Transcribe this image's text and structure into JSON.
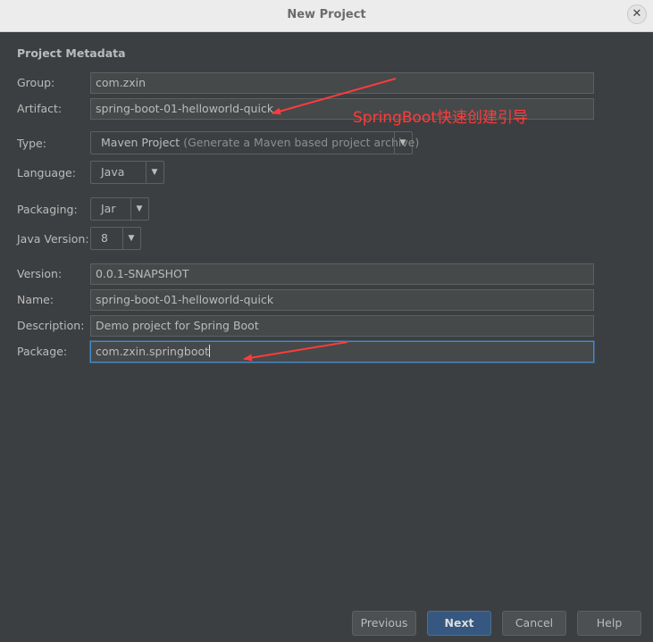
{
  "window": {
    "title": "New Project",
    "close_label": "✕"
  },
  "section": {
    "title": "Project Metadata"
  },
  "fields": {
    "group": {
      "label": "Group:",
      "value": "com.zxin"
    },
    "artifact": {
      "label": "Artifact:",
      "value": "spring-boot-01-helloworld-quick"
    },
    "type": {
      "label": "Type:",
      "value": "Maven Project",
      "hint": "(Generate a Maven based project archive)"
    },
    "language": {
      "label": "Language:",
      "value": "Java"
    },
    "packaging": {
      "label": "Packaging:",
      "value": "Jar"
    },
    "java_version": {
      "label": "Java Version:",
      "value": "8"
    },
    "version": {
      "label": "Version:",
      "value": "0.0.1-SNAPSHOT"
    },
    "name": {
      "label": "Name:",
      "value": "spring-boot-01-helloworld-quick"
    },
    "description": {
      "label": "Description:",
      "value": "Demo project for Spring Boot"
    },
    "package": {
      "label": "Package:",
      "value": "com.zxin.springboot"
    }
  },
  "annotation": {
    "text": "SpringBoot快速创建引导",
    "color": "#ff3b3b"
  },
  "buttons": {
    "previous": "Previous",
    "next": "Next",
    "cancel": "Cancel",
    "help": "Help"
  },
  "icons": {
    "dropdown": "▼"
  },
  "colors": {
    "background": "#3c3f41",
    "field_bg": "#45494a",
    "focus_border": "#4a88c7",
    "default_button": "#365880",
    "annotation": "#ff3b3b"
  }
}
